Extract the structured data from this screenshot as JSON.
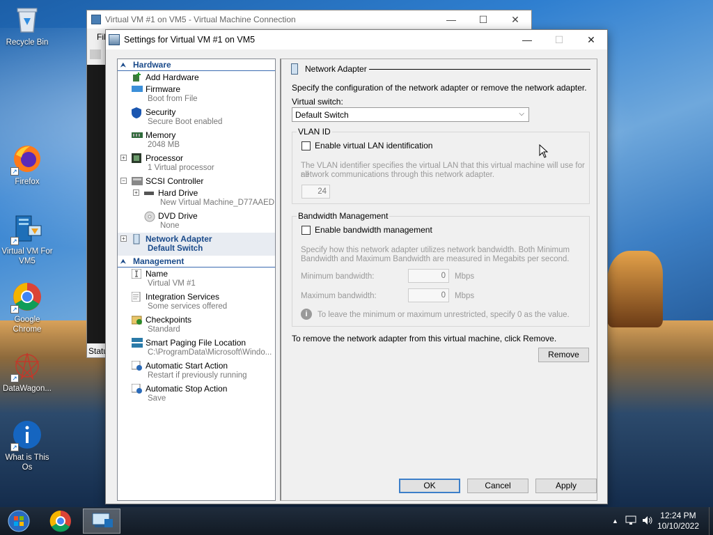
{
  "desktop": {
    "icons": [
      {
        "label": "Recycle Bin"
      },
      {
        "label": "Firefox"
      },
      {
        "label": "Virtual VM For VM5"
      },
      {
        "label": "Google Chrome"
      },
      {
        "label": "DataWagon..."
      },
      {
        "label": "What is This Os"
      }
    ]
  },
  "back_window": {
    "title": "Virtual VM #1 on VM5 - Virtual Machine Connection",
    "menu_fragment": "Fil",
    "status_fragment": "Statu"
  },
  "dialog": {
    "title": "Settings for Virtual VM #1 on VM5",
    "controls": {
      "minimize": "—",
      "maximize": "☐",
      "close": "✕"
    },
    "tree": {
      "hardware_header": "Hardware",
      "management_header": "Management",
      "hardware_items": [
        {
          "label": "Add Hardware",
          "sub": "",
          "icon": "add-hardware-icon"
        },
        {
          "label": "Firmware",
          "sub": "Boot from File",
          "icon": "firmware-icon"
        },
        {
          "label": "Security",
          "sub": "Secure Boot enabled",
          "icon": "shield-icon"
        },
        {
          "label": "Memory",
          "sub": "2048 MB",
          "icon": "memory-icon"
        },
        {
          "label": "Processor",
          "sub": "1 Virtual processor",
          "icon": "processor-icon"
        },
        {
          "label": "SCSI Controller",
          "sub": "",
          "icon": "scsi-controller-icon"
        },
        {
          "label": "Hard Drive",
          "sub": "New Virtual Machine_D77AAED...",
          "icon": "hard-drive-icon"
        },
        {
          "label": "DVD Drive",
          "sub": "None",
          "icon": "dvd-drive-icon"
        },
        {
          "label": "Network Adapter",
          "sub": "Default Switch",
          "icon": "network-adapter-icon"
        }
      ],
      "management_items": [
        {
          "label": "Name",
          "sub": "Virtual VM #1",
          "icon": "name-icon"
        },
        {
          "label": "Integration Services",
          "sub": "Some services offered",
          "icon": "integration-services-icon"
        },
        {
          "label": "Checkpoints",
          "sub": "Standard",
          "icon": "checkpoints-icon"
        },
        {
          "label": "Smart Paging File Location",
          "sub": "C:\\ProgramData\\Microsoft\\Windo...",
          "icon": "smart-paging-icon"
        },
        {
          "label": "Automatic Start Action",
          "sub": "Restart if previously running",
          "icon": "auto-start-icon"
        },
        {
          "label": "Automatic Stop Action",
          "sub": "Save",
          "icon": "auto-stop-icon"
        }
      ]
    },
    "panel": {
      "title": "Network Adapter",
      "description": "Specify the configuration of the network adapter or remove the network adapter.",
      "virtual_switch_label": "Virtual switch:",
      "virtual_switch_value": "Default Switch",
      "vlan": {
        "group_title": "VLAN ID",
        "checkbox_label": "Enable virtual LAN identification",
        "checked": false,
        "help_line1": "The VLAN identifier specifies the virtual LAN that this virtual machine will use for all",
        "help_line2": "network communications through this network adapter.",
        "value": "24"
      },
      "bandwidth": {
        "group_title": "Bandwidth Management",
        "checkbox_label": "Enable bandwidth management",
        "checked": false,
        "help_line1": "Specify how this network adapter utilizes network bandwidth. Both Minimum",
        "help_line2": "Bandwidth and Maximum Bandwidth are measured in Megabits per second.",
        "min_label": "Minimum bandwidth:",
        "min_value": "0",
        "max_label": "Maximum bandwidth:",
        "max_value": "0",
        "unit": "Mbps",
        "info_text": "To leave the minimum or maximum unrestricted, specify 0 as the value."
      },
      "remove_text": "To remove the network adapter from this virtual machine, click Remove.",
      "remove_button": "Remove"
    },
    "buttons": {
      "ok": "OK",
      "cancel": "Cancel",
      "apply": "Apply"
    }
  },
  "taskbar": {
    "time": "12:24 PM",
    "date": "10/10/2022"
  }
}
